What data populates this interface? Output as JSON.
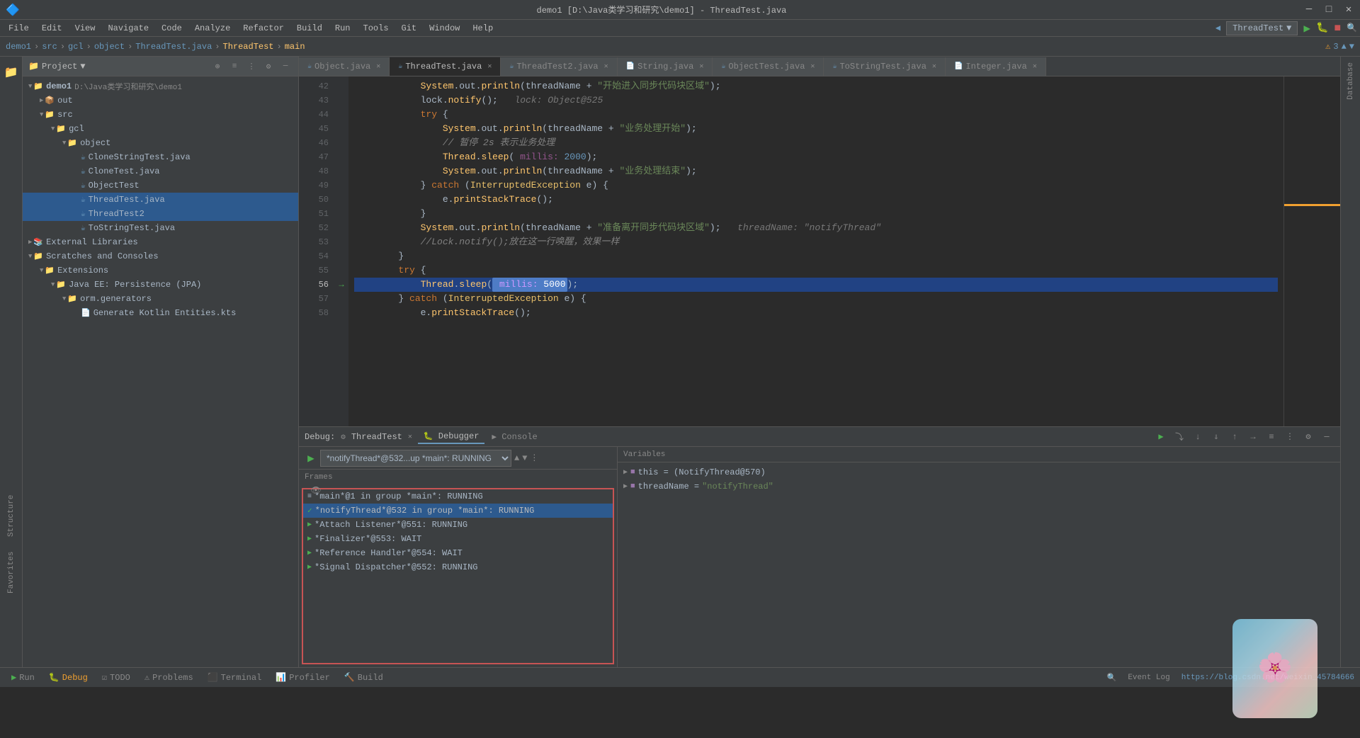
{
  "window": {
    "title": "demo1 [D:\\Java类学习和研究\\demo1] - ThreadTest.java",
    "min": "─",
    "max": "□",
    "close": "✕"
  },
  "menu": {
    "items": [
      "File",
      "Edit",
      "View",
      "Navigate",
      "Code",
      "Analyze",
      "Refactor",
      "Build",
      "Run",
      "Tools",
      "Git",
      "Window",
      "Help"
    ]
  },
  "nav": {
    "breadcrumbs": [
      "demo1",
      "src",
      "gcl",
      "object",
      "ThreadTest.java",
      "ThreadTest",
      "main"
    ]
  },
  "tabs": [
    {
      "label": "Object.java",
      "active": false,
      "modified": false
    },
    {
      "label": "ThreadTest.java",
      "active": true,
      "modified": true
    },
    {
      "label": "ThreadTest2.java",
      "active": false,
      "modified": false
    },
    {
      "label": "String.java",
      "active": false,
      "modified": false
    },
    {
      "label": "ObjectTest.java",
      "active": false,
      "modified": false
    },
    {
      "label": "ToStringTest.java",
      "active": false,
      "modified": false
    },
    {
      "label": "Integer.java",
      "active": false,
      "modified": false
    }
  ],
  "project": {
    "title": "Project",
    "root": "demo1",
    "root_path": "D:\\Java类学习和研究\\demo1",
    "items": [
      {
        "indent": 0,
        "type": "folder",
        "label": "demo1 D:\\Java类学习和研究\\demo1",
        "expanded": true
      },
      {
        "indent": 1,
        "type": "folder",
        "label": "out",
        "expanded": false
      },
      {
        "indent": 1,
        "type": "folder",
        "label": "src",
        "expanded": true
      },
      {
        "indent": 2,
        "type": "folder",
        "label": "gcl",
        "expanded": true
      },
      {
        "indent": 3,
        "type": "folder",
        "label": "object",
        "expanded": true
      },
      {
        "indent": 4,
        "type": "file",
        "label": "CloneStringTest.java"
      },
      {
        "indent": 4,
        "type": "file",
        "label": "CloneTest.java"
      },
      {
        "indent": 4,
        "type": "file",
        "label": "ObjectTest"
      },
      {
        "indent": 4,
        "type": "file",
        "label": "ThreadTest.java",
        "selected": true
      },
      {
        "indent": 4,
        "type": "file",
        "label": "ThreadTest2",
        "selected": false
      },
      {
        "indent": 4,
        "type": "file",
        "label": "ToStringTest.java"
      }
    ],
    "extra": [
      {
        "indent": 0,
        "type": "folder",
        "label": "External Libraries",
        "expanded": false
      },
      {
        "indent": 0,
        "type": "folder",
        "label": "Scratches and Consoles",
        "expanded": true
      },
      {
        "indent": 1,
        "type": "folder",
        "label": "Extensions",
        "expanded": true
      },
      {
        "indent": 2,
        "type": "folder",
        "label": "Java EE: Persistence (JPA)",
        "expanded": true
      },
      {
        "indent": 3,
        "type": "folder",
        "label": "orm.generators",
        "expanded": true
      },
      {
        "indent": 4,
        "type": "file",
        "label": "Generate Kotlin Entities.kts"
      }
    ]
  },
  "code": {
    "lines": [
      {
        "num": 42,
        "text": "            System.out.println(threadName + \"开始进入同步代码块区域\");"
      },
      {
        "num": 43,
        "text": "            lock.notify();  // lock: Object@525"
      },
      {
        "num": 44,
        "text": "            try {"
      },
      {
        "num": 45,
        "text": "                System.out.println(threadName + \"业务处理开始\");"
      },
      {
        "num": 46,
        "text": "                // 暂停 2s 表示业务处理"
      },
      {
        "num": 47,
        "text": "                Thread.sleep( millis: 2000);"
      },
      {
        "num": 48,
        "text": "                System.out.println(threadName + \"业务处理结束\");"
      },
      {
        "num": 49,
        "text": "            } catch (InterruptedException e) {"
      },
      {
        "num": 50,
        "text": "                e.printStackTrace();"
      },
      {
        "num": 51,
        "text": "            }"
      },
      {
        "num": 52,
        "text": "            System.out.println(threadName + \"准备离开同步代码块区域\");  // threadName: \"notifyThread\""
      },
      {
        "num": 53,
        "text": "            //Lock.notify();放在这一行唤醒，效果一样"
      },
      {
        "num": 54,
        "text": "        }"
      },
      {
        "num": 55,
        "text": "        try {"
      },
      {
        "num": 56,
        "text": "            Thread.sleep( millis: 5000);",
        "highlighted": true
      },
      {
        "num": 57,
        "text": "        } catch (InterruptedException e) {"
      },
      {
        "num": 58,
        "text": "            e.printStackTrace();"
      }
    ]
  },
  "debug": {
    "title": "Debug:",
    "run_config": "ThreadTest",
    "tabs": [
      "Debugger",
      "Console"
    ],
    "active_tab": "Debugger",
    "thread_dropdown": "*notifyThread*@532...up *main*: RUNNING",
    "frames_label": "Frames",
    "variables_label": "Variables",
    "threads": [
      {
        "label": "*main*@1 in group *main*: RUNNING",
        "status": "RUNNING",
        "type": "main"
      },
      {
        "label": "*notifyThread*@532 in group *main*: RUNNING",
        "status": "RUNNING",
        "type": "notify",
        "active": true
      },
      {
        "label": "*Attach Listener*@551: RUNNING",
        "status": "RUNNING",
        "type": "attach"
      },
      {
        "label": "*Finalizer*@553: WAIT",
        "status": "WAIT",
        "type": "finalizer"
      },
      {
        "label": "*Reference Handler*@554: WAIT",
        "status": "WAIT",
        "type": "ref"
      },
      {
        "label": "*Signal Dispatcher*@552: RUNNING",
        "status": "RUNNING",
        "type": "signal"
      }
    ],
    "variables": [
      {
        "label": "this = (NotifyThread@570)",
        "expanded": false,
        "type": "obj"
      },
      {
        "label": "threadName = \"notifyThread\"",
        "expanded": false,
        "type": "str"
      }
    ]
  },
  "bottom_bar": {
    "buttons": [
      "Run",
      "Debug",
      "TODO",
      "Problems",
      "Terminal",
      "Profiler",
      "Build"
    ],
    "active": "Debug",
    "status_url": "https://blog.csdn.net/weixin_45784666"
  }
}
